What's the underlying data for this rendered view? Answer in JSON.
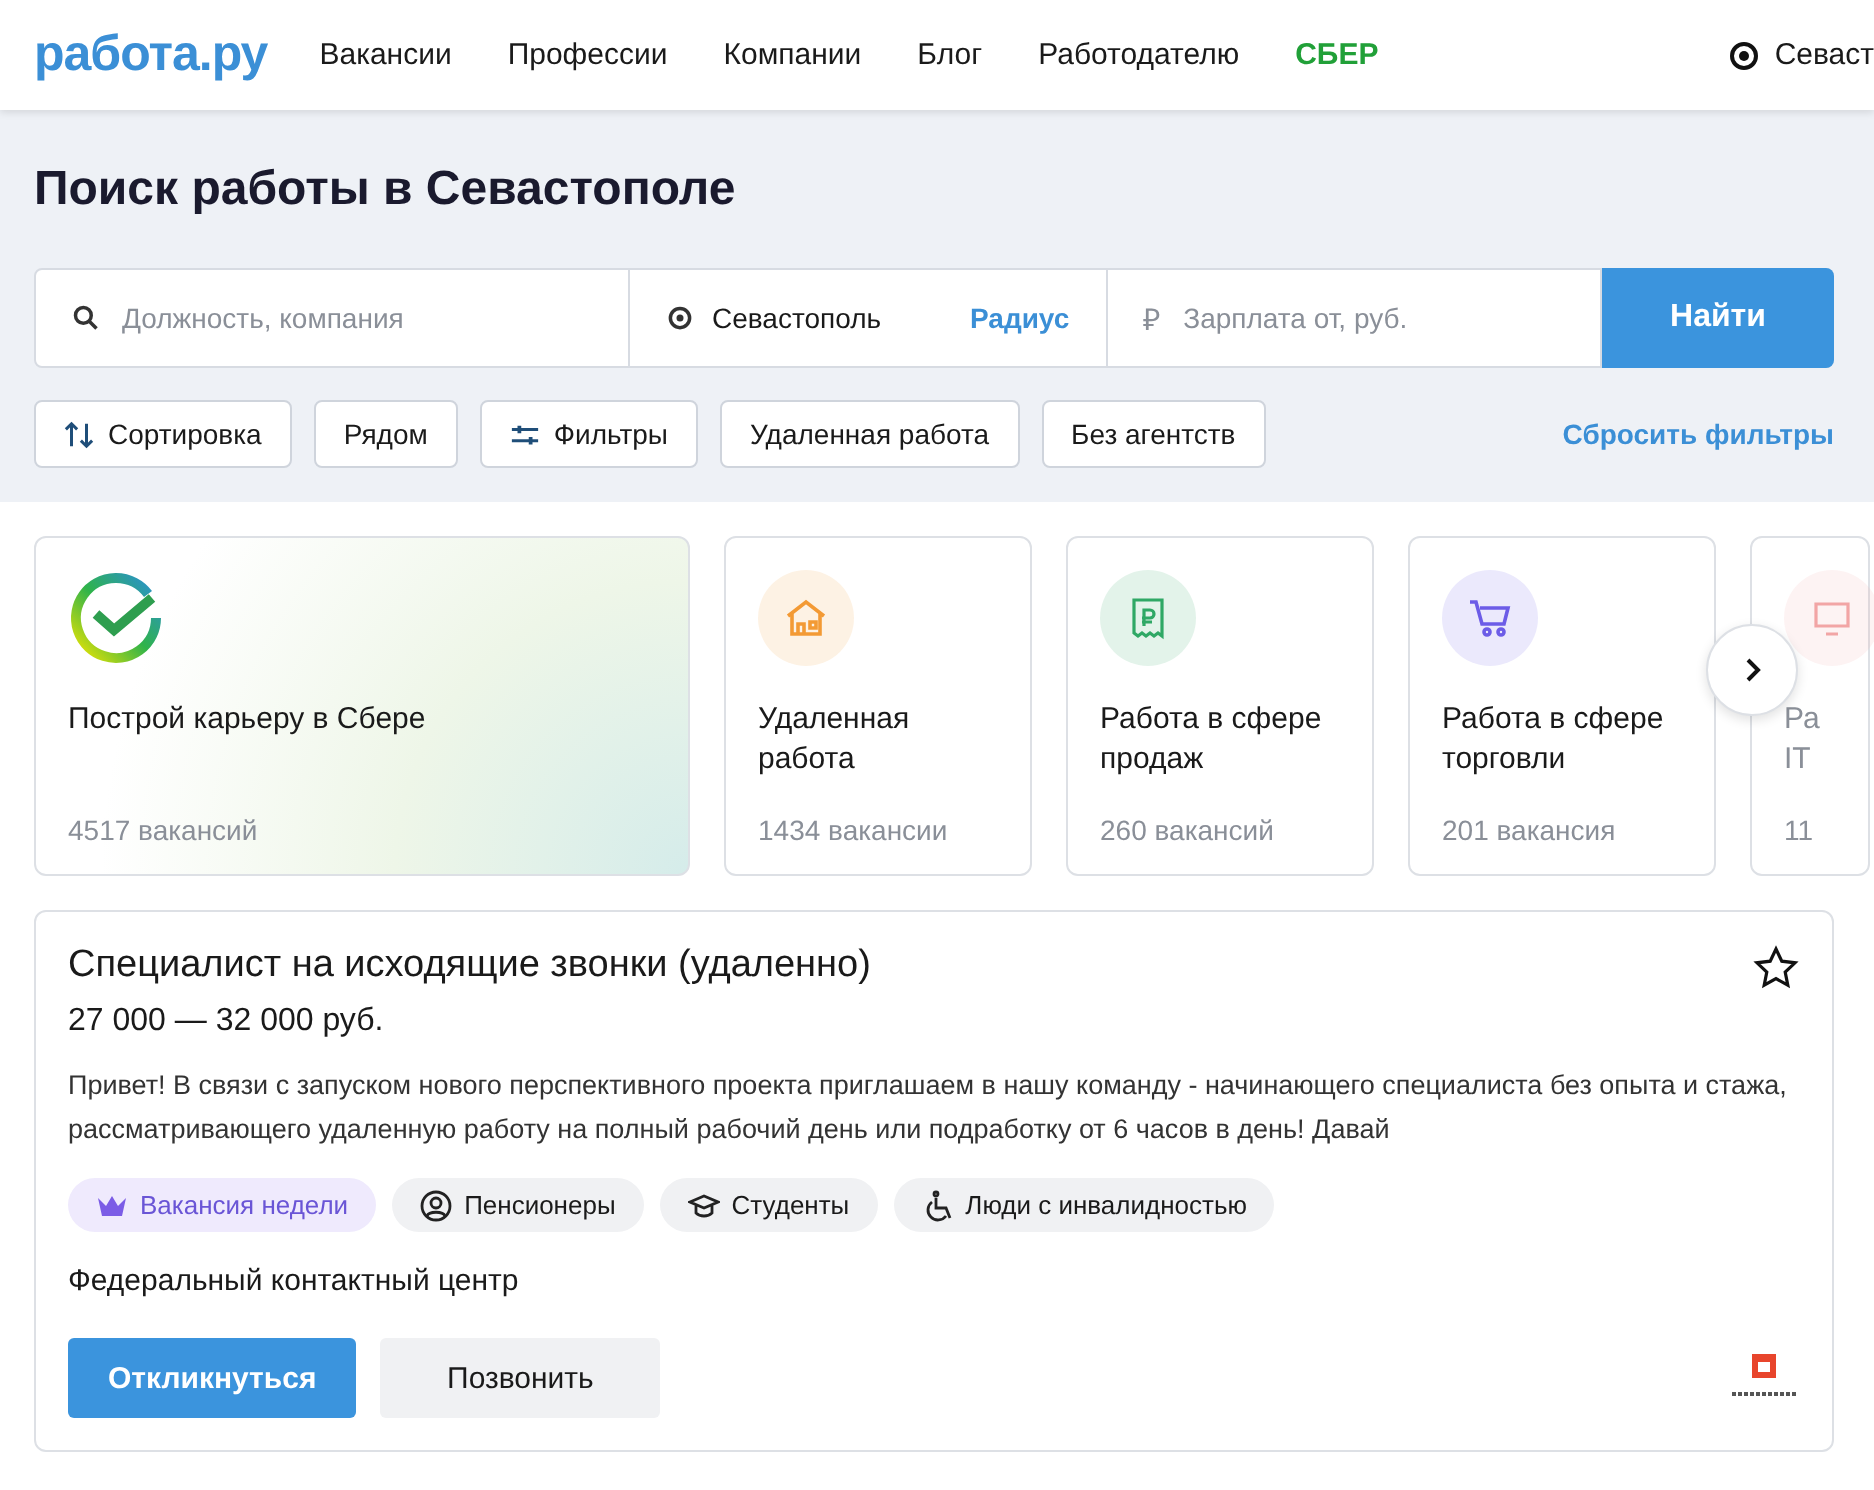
{
  "header": {
    "logo": "работа.ру",
    "nav": [
      {
        "label": "Вакансии",
        "kind": "link"
      },
      {
        "label": "Профессии",
        "kind": "link"
      },
      {
        "label": "Компании",
        "kind": "link"
      },
      {
        "label": "Блог",
        "kind": "link"
      },
      {
        "label": "Работодателю",
        "kind": "link"
      },
      {
        "label": "СБЕР",
        "kind": "brand"
      }
    ],
    "location": "Севаст"
  },
  "title": "Поиск работы в Севастополе",
  "search": {
    "query_placeholder": "Должность, компания",
    "city": "Севастополь",
    "radius": "Радиус",
    "currency": "₽",
    "salary_placeholder": "Зарплата от, руб.",
    "button": "Найти"
  },
  "filters": [
    {
      "label": "Сортировка",
      "kind": "sort"
    },
    {
      "label": "Рядом",
      "kind": "plain"
    },
    {
      "label": "Фильтры",
      "kind": "sliders"
    },
    {
      "label": "Удаленная работа",
      "kind": "plain"
    },
    {
      "label": "Без агентств",
      "kind": "plain"
    }
  ],
  "reset_filters": "Сбросить фильтры",
  "categories": [
    {
      "kind": "sber",
      "title": "Построй карьеру в Сбере",
      "count": "4517 вакансий",
      "color": "#2e9e4f"
    },
    {
      "kind": "house",
      "title": "Удаленная работа",
      "count": "1434 вакансии",
      "color": "#f39a34"
    },
    {
      "kind": "receipt",
      "title": "Работа в сфере продаж",
      "count": "260 вакансий",
      "color": "#2fa865"
    },
    {
      "kind": "cart",
      "title": "Работа в сфере торговли",
      "count": "201 вакансия",
      "color": "#6c5ce7"
    },
    {
      "kind": "partial",
      "title": "Ра IT",
      "count": "11",
      "color": "#f2a5a5"
    }
  ],
  "vacancy": {
    "title": "Специалист на исходящие звонки (удаленно)",
    "salary": "27 000 — 32 000 руб.",
    "favorite": false,
    "description": "Привет! В связи с запуском нового перспективного проекта приглашаем в нашу команду - начинающего специалиста без опыта и стажа, рассматривающего удаленную работу на полный рабочий день или подработку от 6 часов в день! Давай",
    "tags": [
      {
        "label": "Вакансия недели",
        "kind": "crown",
        "highlighted": true
      },
      {
        "label": "Пенсионеры",
        "kind": "person",
        "highlighted": false
      },
      {
        "label": "Студенты",
        "kind": "cap",
        "highlighted": false
      },
      {
        "label": "Люди с инвалидностью",
        "kind": "wheelchair",
        "highlighted": false
      }
    ],
    "company": "Федеральный контактный центр",
    "buttons": [
      {
        "label": "Откликнуться",
        "kind": "primary"
      },
      {
        "label": "Позвонить",
        "kind": "secondary"
      }
    ]
  }
}
